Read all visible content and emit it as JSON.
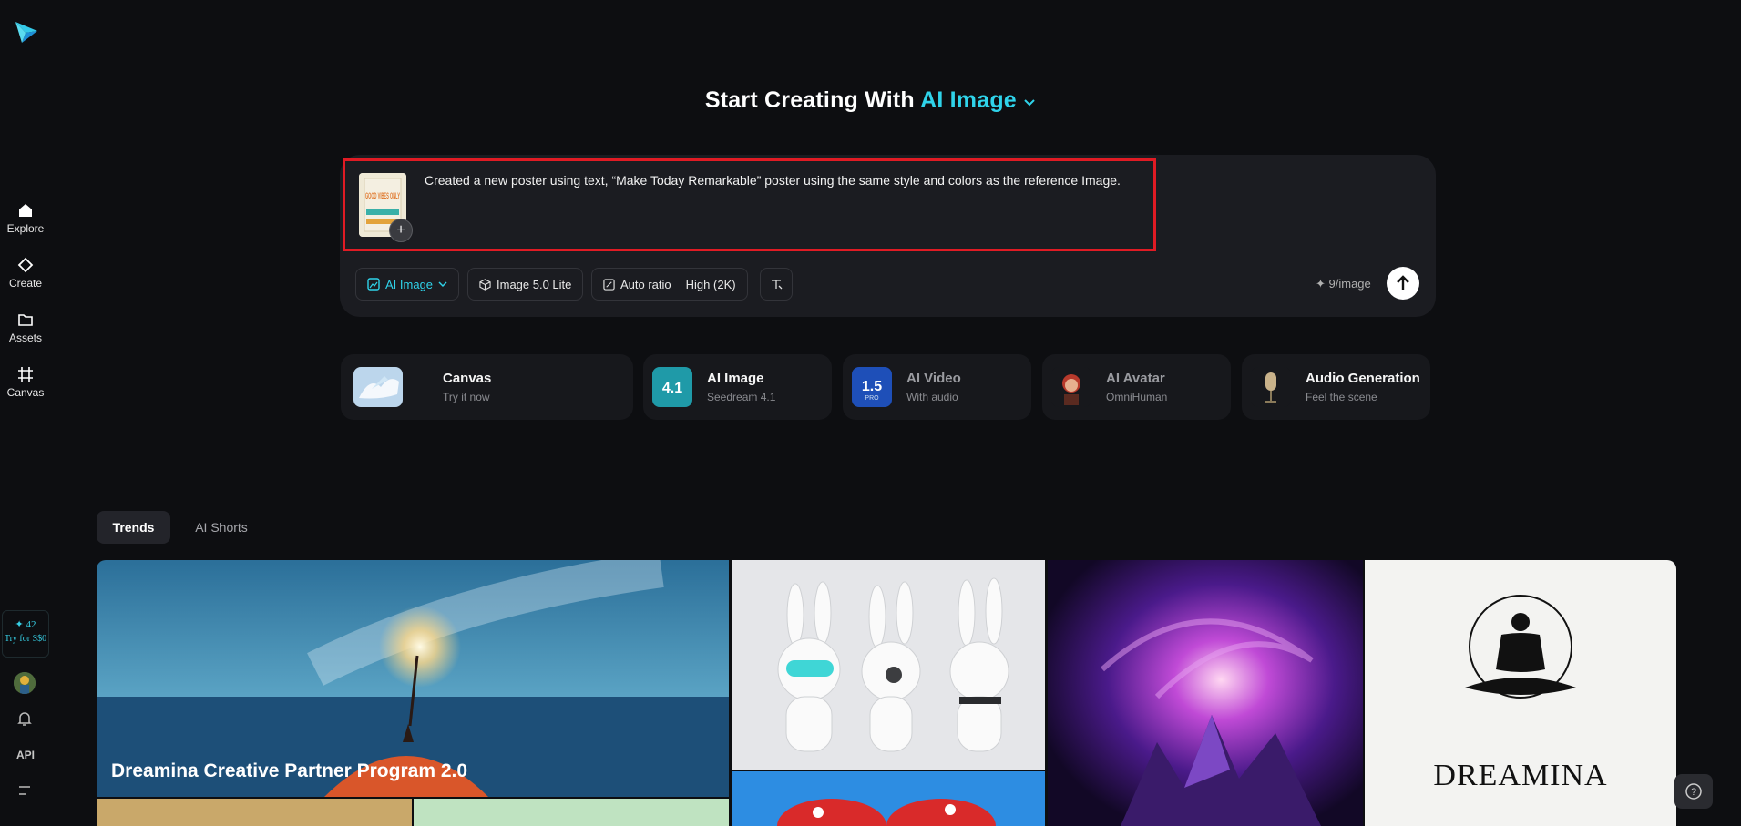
{
  "sidebar": {
    "items": [
      {
        "label": "Explore",
        "icon": "home-icon"
      },
      {
        "label": "Create",
        "icon": "diamond-icon"
      },
      {
        "label": "Assets",
        "icon": "folder-icon"
      },
      {
        "label": "Canvas",
        "icon": "canvas-icon"
      }
    ],
    "promo": {
      "credits": "✦ 42",
      "label": "Try for S$0"
    },
    "api_label": "API"
  },
  "header": {
    "title_prefix": "Start Creating With",
    "title_accent": "AI Image"
  },
  "composer": {
    "prompt": "Created a new poster using text, “Make Today Remarkable” poster using the same style and colors as the reference Image.",
    "reference_thumb_text": "GOOD VIBES ONLY",
    "toolbar": {
      "mode": "AI Image",
      "model": "Image 5.0 Lite",
      "ratio": "Auto ratio",
      "quality": "High (2K)"
    },
    "cost": "✦ 9/image"
  },
  "feature_cards": [
    {
      "title": "Canvas",
      "subtitle": "Try it now"
    },
    {
      "title": "AI Image",
      "subtitle": "Seedream 4.1",
      "badge": "4.1"
    },
    {
      "title": "AI Video",
      "subtitle": "With audio",
      "badge": "1.5",
      "badge_sub": "PRO"
    },
    {
      "title": "AI Avatar",
      "subtitle": "OmniHuman"
    },
    {
      "title": "Audio Generation",
      "subtitle": "Feel the scene"
    }
  ],
  "tabs": [
    {
      "label": "Trends"
    },
    {
      "label": "AI Shorts"
    }
  ],
  "gallery": {
    "banner": "Dreamina Creative Partner Program 2.0",
    "logo_text": "DREAMINA"
  },
  "colors": {
    "accent": "#2fd3ea",
    "highlight": "#e01b24",
    "background": "#0d0e11",
    "panel": "#1b1c21"
  }
}
